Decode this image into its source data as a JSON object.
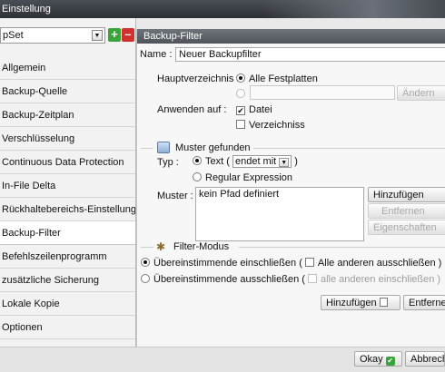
{
  "window": {
    "title": "Einstellung"
  },
  "left": {
    "set_select": "pSet",
    "menu": [
      "Allgemein",
      "Backup-Quelle",
      "Backup-Zeitplan",
      "Verschlüsselung",
      "Continuous Data Protection",
      "In-File Delta",
      "Rückhaltebereichs-Einstellung",
      "Backup-Filter",
      "Befehlszeilenprogramm",
      "zusätzliche Sicherung",
      "Lokale Kopie",
      "Optionen"
    ],
    "active_index": 7
  },
  "right": {
    "panel_title": "Backup-Filter",
    "name_label": "Name :",
    "name_value": "Neuer Backupfilter",
    "hauptverzeichnis_label": "Hauptverzeichnis :",
    "alle_festplatten": "Alle Festplatten",
    "aendern_btn": "Ändern",
    "anwenden_label": "Anwenden auf :",
    "datei": "Datei",
    "verzeichniss": "Verzeichniss",
    "muster_section": "Muster gefunden",
    "typ_label": "Typ :",
    "text_option": "Text (",
    "endet_mit": "endet mit",
    "text_close": ")",
    "regex_option": "Regular Expression",
    "muster_label": "Muster :",
    "muster_value": "kein Pfad definiert",
    "hinzufuegen_btn": "Hinzufügen",
    "entfernen_btn": "Entfernen",
    "eigenschaften_btn": "Eigenschaften",
    "filter_section": "Filter-Modus",
    "mode1_a": "Übereinstimmende einschließen (",
    "mode1_b": "Alle anderen ausschließen )",
    "mode2_a": "Übereinstimmende ausschließen (",
    "mode2_b": "alle anderen einschließen )",
    "hinzufuegen2_btn": "Hinzufügen",
    "entferne_btn": "Entferne"
  },
  "footer": {
    "okay_btn": "Okay",
    "abbrech_btn": "Abbrech"
  },
  "colors": {
    "accent_green": "#3aa43a",
    "minus_red": "#d03030",
    "titlebar": "#3a3f45"
  }
}
